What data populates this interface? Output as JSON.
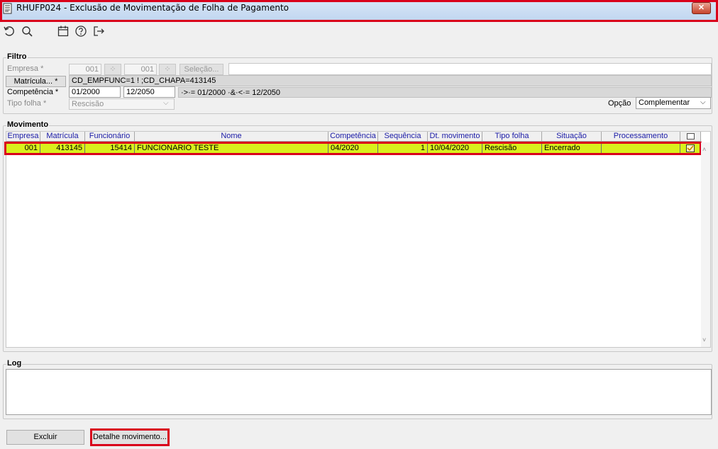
{
  "window": {
    "title": "RHUFP024 - Exclusão de Movimentação de Folha de Pagamento",
    "close_label": "✕"
  },
  "toolbar": {
    "icons": [
      "refresh-icon",
      "search-icon",
      "calendar-icon",
      "help-icon",
      "exit-icon"
    ]
  },
  "filtro": {
    "group_label": "Filtro",
    "empresa_label": "Empresa *",
    "empresa_from": "001",
    "empresa_to": "001",
    "selecao_label": "Seleção...",
    "matricula_button": "Matrícula... *",
    "matricula_filter": "CD_EMPFUNC=1 ǃ ;CD_CHAPA=413145",
    "competencia_label": "Competência *",
    "competencia_from": "01/2000",
    "competencia_to": "12/2050",
    "competencia_expr": "·>·= 01/2000 ·&·<·= 12/2050",
    "tipo_folha_label": "Tipo folha *",
    "tipo_folha_value": "Rescisão",
    "opcao_label": "Opção",
    "opcao_value": "Complementar"
  },
  "movimento": {
    "group_label": "Movimento",
    "columns": [
      "Empresa",
      "Matrícula",
      "Funcionário",
      "Nome",
      "Competência",
      "Sequência",
      "Dt. movimento",
      "Tipo folha",
      "Situação",
      "Processamento"
    ],
    "rows": [
      {
        "empresa": "001",
        "matricula": "413145",
        "funcionario": "15414",
        "nome": "FUNCIONARIO TESTE",
        "competencia": "04/2020",
        "sequencia": "1",
        "dt_movimento": "10/04/2020",
        "tipo_folha": "Rescisão",
        "situacao": "Encerrado",
        "processamento": "",
        "checked": true
      }
    ],
    "row_color": "#d9f01c"
  },
  "log": {
    "group_label": "Log"
  },
  "buttons": {
    "excluir": "Excluir",
    "detalhe": "Detalhe movimento..."
  },
  "colors": {
    "highlight_red": "#d9001b",
    "header_text": "#1a1aa6"
  }
}
